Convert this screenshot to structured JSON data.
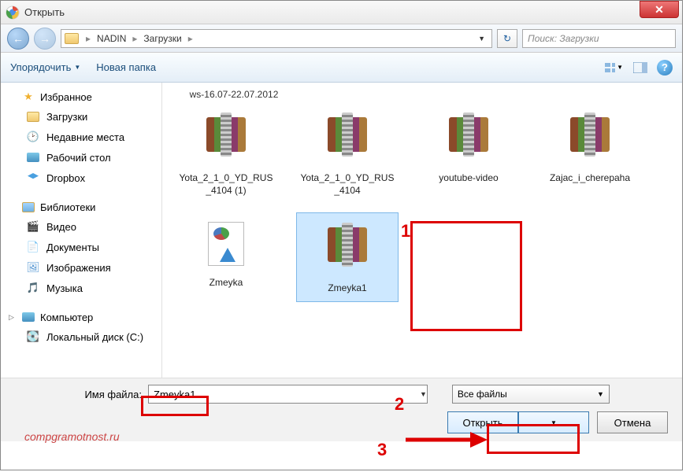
{
  "title": "Открыть",
  "addressbar": {
    "parts": [
      "NADIN",
      "Загрузки"
    ]
  },
  "search": {
    "placeholder": "Поиск: Загрузки"
  },
  "toolbar": {
    "organize": "Упорядочить",
    "new_folder": "Новая папка"
  },
  "sidebar": {
    "favorites": {
      "label": "Избранное",
      "items": [
        "Загрузки",
        "Недавние места",
        "Рабочий стол",
        "Dropbox"
      ]
    },
    "libraries": {
      "label": "Библиотеки",
      "items": [
        "Видео",
        "Документы",
        "Изображения",
        "Музыка"
      ]
    },
    "computer": {
      "label": "Компьютер",
      "items": [
        "Локальный диск (С:)"
      ]
    }
  },
  "partial_file": "ws-16.07-22.07.2012",
  "files": [
    {
      "name": "Yota_2_1_0_YD_RUS_4104 (1)",
      "type": "rar"
    },
    {
      "name": "Yota_2_1_0_YD_RUS_4104",
      "type": "rar"
    },
    {
      "name": "youtube-video",
      "type": "rar"
    },
    {
      "name": "Zajac_i_cherepaha",
      "type": "rar"
    },
    {
      "name": "Zmeyka",
      "type": "doc"
    },
    {
      "name": "Zmeyka1",
      "type": "rar",
      "selected": true
    }
  ],
  "footer": {
    "filename_label": "Имя файла:",
    "filename_value": "Zmeyka1",
    "filter": "Все файлы",
    "open": "Открыть",
    "cancel": "Отмена"
  },
  "watermark": "compgramotnost.ru",
  "annotations": {
    "n1": "1",
    "n2": "2",
    "n3": "3"
  }
}
